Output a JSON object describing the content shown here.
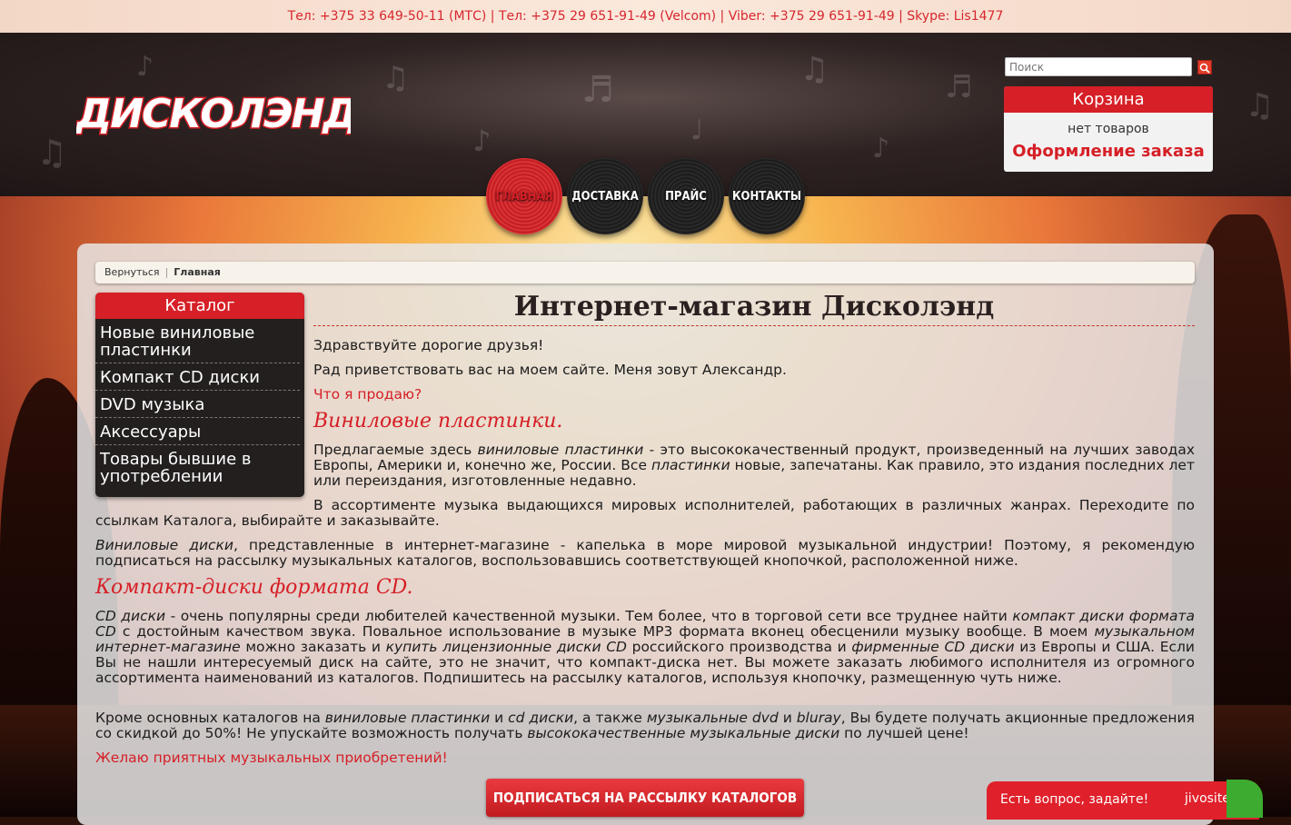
{
  "topbar": {
    "contacts": "Тел: +375 33 649-50-11 (МТС) | Тел: +375 29 651-91-49 (Velcom) | Viber: +375 29 651-91-49 | Skype: Lis1477"
  },
  "logo": {
    "text": "ДИСКОЛЭНД"
  },
  "search": {
    "placeholder": "Поиск"
  },
  "cart": {
    "title": "Корзина",
    "empty": "нет товаров",
    "checkout": "Оформление заказа"
  },
  "nav": [
    {
      "label": "ГЛАВНАЯ"
    },
    {
      "label": "ДОСТАВКА"
    },
    {
      "label": "ПРАЙС"
    },
    {
      "label": "КОНТАКТЫ"
    }
  ],
  "breadcrumb": {
    "back": "Вернуться",
    "current": "Главная"
  },
  "catalog": {
    "title": "Каталог",
    "items": [
      "Новые виниловые пластинки",
      "Компакт CD диски",
      "DVD музыка",
      "Аксессуары",
      "Товары бывшие в употреблении"
    ]
  },
  "content": {
    "title": "Интернет-магазин Дисколэнд",
    "greeting": "Здравствуйте дорогие друзья!",
    "intro": "Рад приветствовать вас на моем сайте. Меня зовут Александр.",
    "what_sell": "Что я продаю?",
    "vinyl_heading": "Виниловые пластинки.",
    "vinyl_p1_a": "Предлагаемые здесь ",
    "vinyl_p1_b": "виниловые пластинки",
    "vinyl_p1_c": " - это высококачественный продукт, произведенный на лучших заводах Европы, Америки и, конечно же, России. Все ",
    "vinyl_p1_d": "пластинки",
    "vinyl_p1_e": " новые, запечатаны. Как правило, это издания последних лет или переиздания, изготовленные недавно.",
    "vinyl_p2": "В ассортименте музыка выдающихся мировых исполнителей, работающих в различных жанрах. Переходите по ссылкам Каталога, выбирайте и заказывайте.",
    "vinyl_p3_a": "Виниловые диски",
    "vinyl_p3_b": ", представленные в интернет-магазине - капелька в море мировой музыкальной индустрии! Поэтому, я рекомендую подписаться на рассылку музыкальных каталогов, воспользовавшись соответствующей кнопочкой, расположенной ниже.",
    "cd_heading": "Компакт-диски формата CD.",
    "cd_p1_a": "CD диски",
    "cd_p1_b": " - очень популярны среди любителей качественной музыки. Тем более, что в торговой сети все труднее найти ",
    "cd_p1_c": "компакт диски формата CD",
    "cd_p1_d": " с достойным качеством звука. Повальное использование в музыке MP3 формата вконец обесценили музыку вообще. В моем ",
    "cd_p1_e": "музыкальном интернет-магазине",
    "cd_p1_f": " можно заказать и ",
    "cd_p1_g": "купить лицензионные диски CD",
    "cd_p1_h": " российского производства и ",
    "cd_p1_i": "фирменные CD диски",
    "cd_p1_j": " из Европы и США. Если Вы не нашли интересуемый диск на сайте, это не значит, что компакт-диска нет. Вы можете заказать любимого исполнителя из огромного ассортимента наименований из каталогов. Подпишитесь на рассылку каталогов, используя кнопочку, размещенную чуть ниже.",
    "cd_p2_a": "Кроме основных каталогов на ",
    "cd_p2_b": "виниловые пластинки",
    "cd_p2_c": " и ",
    "cd_p2_d": "cd диски",
    "cd_p2_e": ", а также ",
    "cd_p2_f": "музыкальные dvd",
    "cd_p2_g": " и ",
    "cd_p2_h": "bluray",
    "cd_p2_i": ", Вы будете получать акционные предложения со скидкой до 50%! Не упускайте возможность получать ",
    "cd_p2_j": "высококачественные музыкальные диски",
    "cd_p2_k": " по лучшей цене!",
    "wish": "Желаю приятных музыкальных приобретений!"
  },
  "subscribe": {
    "label": "ПОДПИСАТЬСЯ НА РАССЫЛКУ КАТАЛОГОВ"
  },
  "chat": {
    "label": "Есть вопрос, задайте!",
    "brand": "jivosite"
  },
  "colors": {
    "accent": "#d61f26",
    "disc_black": "#1b1b1b",
    "panel": "#e8e6e6"
  }
}
